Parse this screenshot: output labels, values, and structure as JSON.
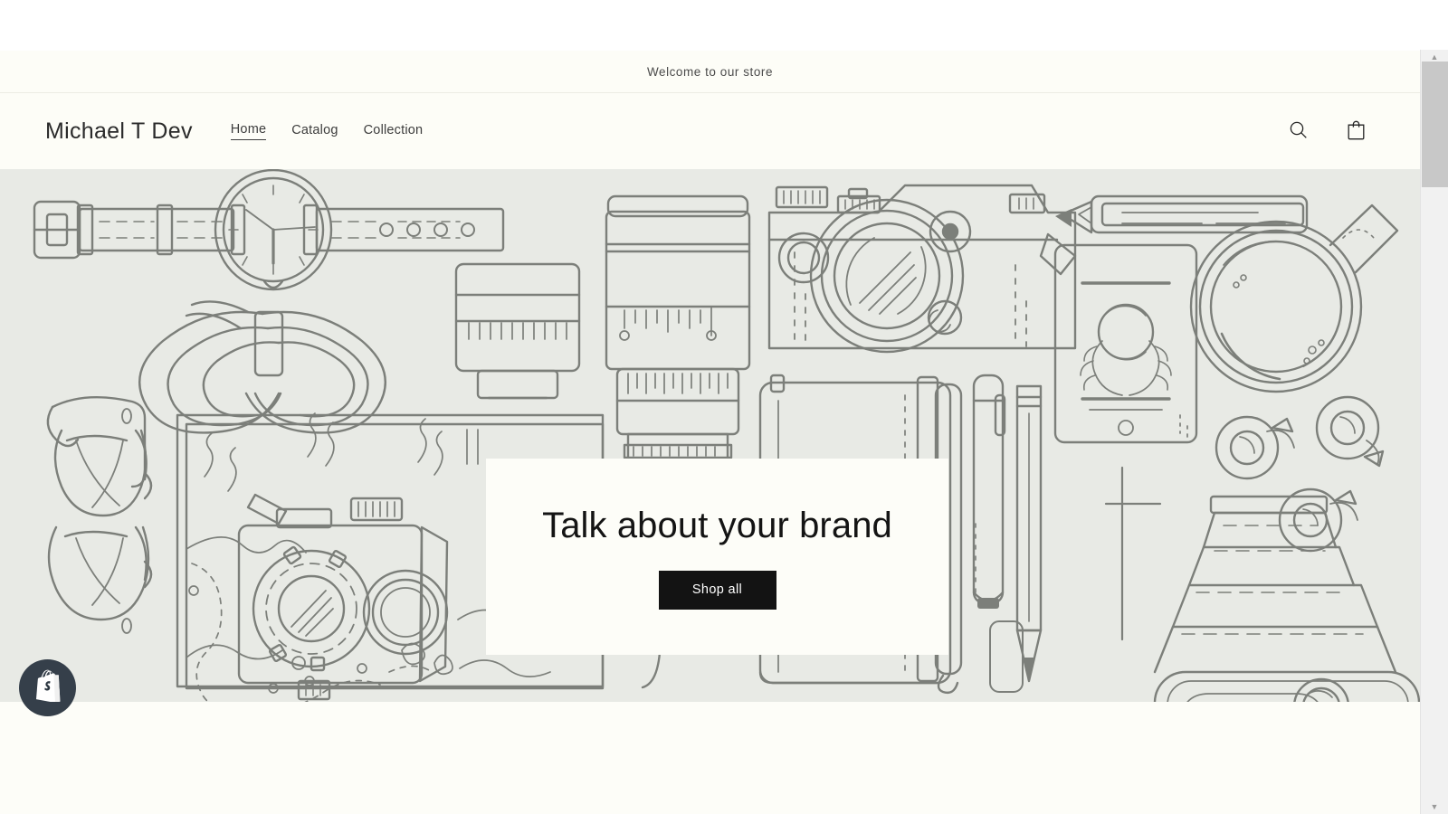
{
  "announcement": {
    "text": "Welcome to our store"
  },
  "header": {
    "logo": "Michael T Dev",
    "nav": [
      {
        "label": "Home",
        "active": true
      },
      {
        "label": "Catalog",
        "active": false
      },
      {
        "label": "Collection",
        "active": false
      }
    ],
    "actions": [
      {
        "name": "search-icon",
        "label": "Search"
      },
      {
        "name": "cart-icon",
        "label": "Cart"
      }
    ]
  },
  "hero": {
    "heading": "Talk about your brand",
    "cta_label": "Shop all",
    "illustration_alt": "Flat-lay line drawing of watch, bow tie, glasses, cameras, lenses, notebook, pencil, pen, coffee cup, map and tape rolls",
    "background_color": "#e8eae5",
    "line_color": "#7c7f7a"
  },
  "badge": {
    "name": "shopify-logo",
    "label": "Shopify",
    "color": "#353f4a"
  },
  "colors": {
    "page_background": "#fdfdf8",
    "announcement_background": "#fdfdf7",
    "header_background": "#fdfdf7",
    "text": "#121212",
    "button_background": "#131313",
    "button_text": "#ffffff"
  },
  "scrollbar": {
    "up_arrow": "▲",
    "down_arrow": "▼"
  }
}
